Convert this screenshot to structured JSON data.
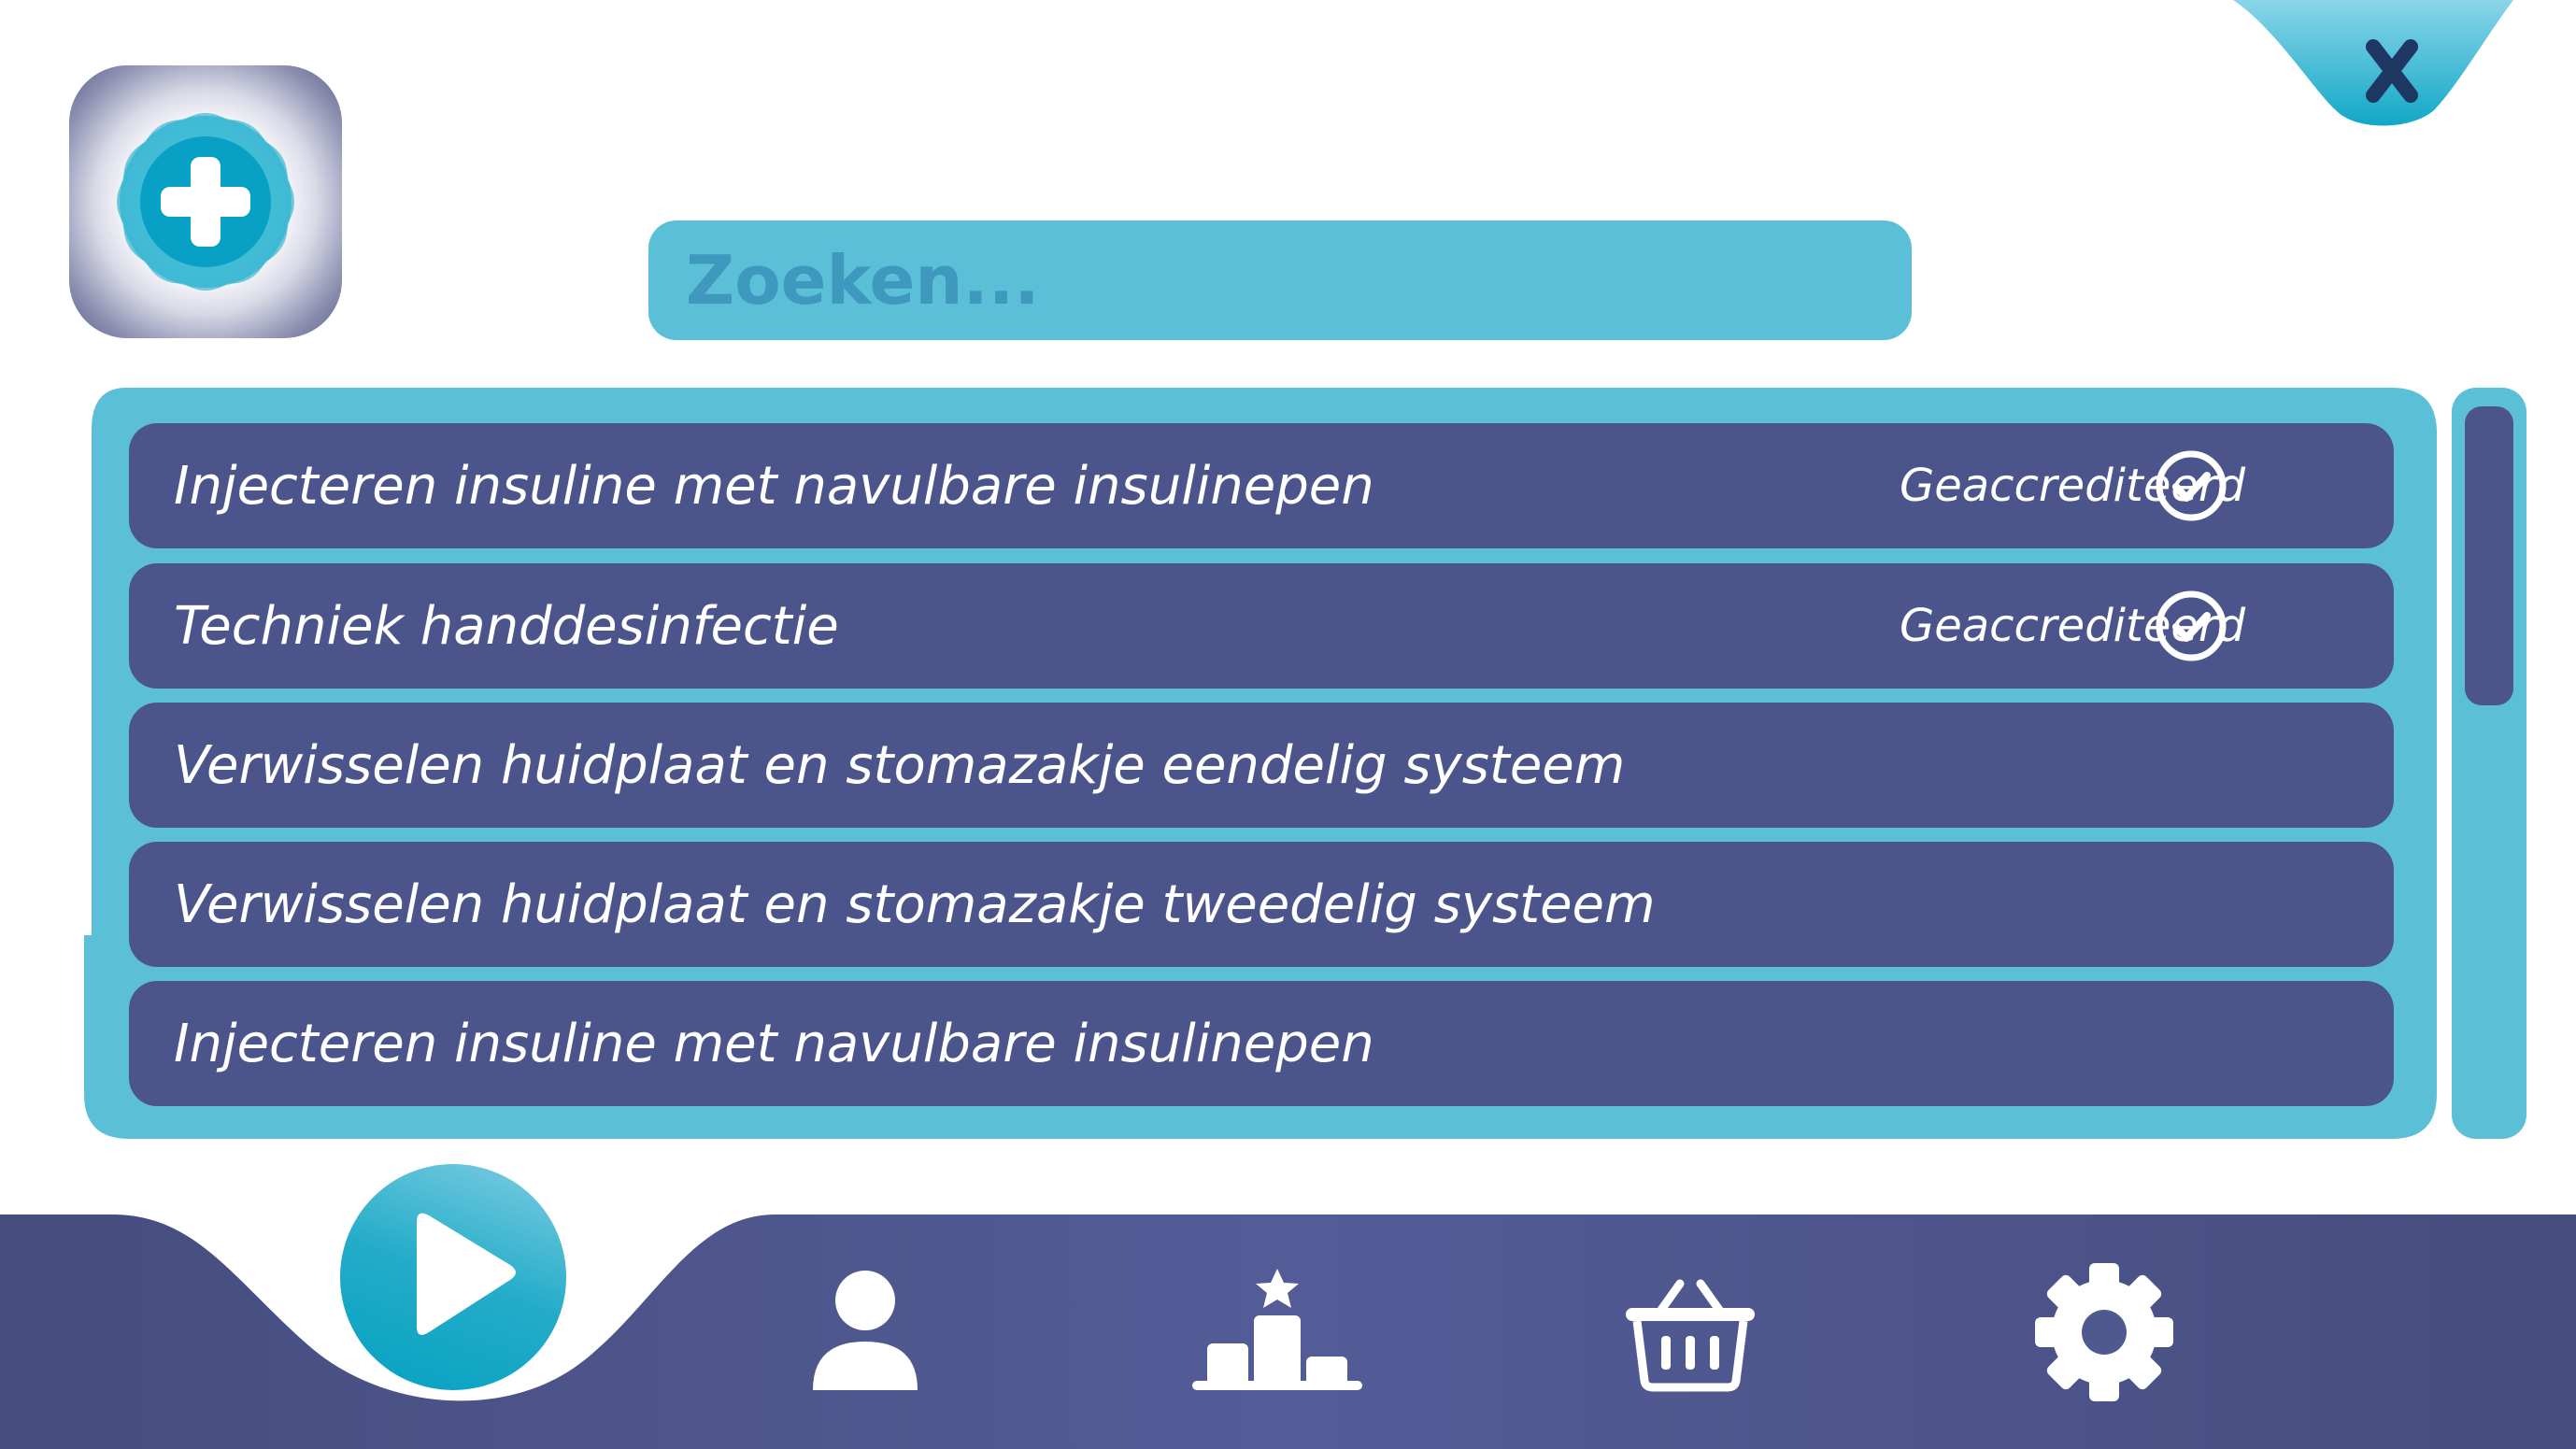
{
  "header": {
    "close_icon": "close-icon",
    "logo_icon": "medical-plus-icon"
  },
  "search": {
    "placeholder": "Zoeken...",
    "value": ""
  },
  "procedures": [
    {
      "title": "Injecteren insuline met navulbare insulinepen",
      "badge": "Geaccrediteerd",
      "accredited": true
    },
    {
      "title": "Techniek handdesinfectie",
      "badge": "Geaccrediteerd",
      "accredited": true
    },
    {
      "title": "Verwisselen huidplaat en stomazakje eendelig systeem",
      "badge": "",
      "accredited": false
    },
    {
      "title": "Verwisselen huidplaat en stomazakje tweedelig systeem",
      "badge": "",
      "accredited": false
    },
    {
      "title": "Injecteren insuline met navulbare insulinepen",
      "badge": "",
      "accredited": false
    }
  ],
  "bottom_nav": {
    "items": [
      "play-icon",
      "profile-icon",
      "leaderboard-icon",
      "shop-basket-icon",
      "settings-gear-icon"
    ]
  },
  "colors": {
    "accent_cyan": "#5bbfd7",
    "row_navy": "#4b548b",
    "nav_navy": "#4b5384",
    "close_color": "#1f3763"
  }
}
